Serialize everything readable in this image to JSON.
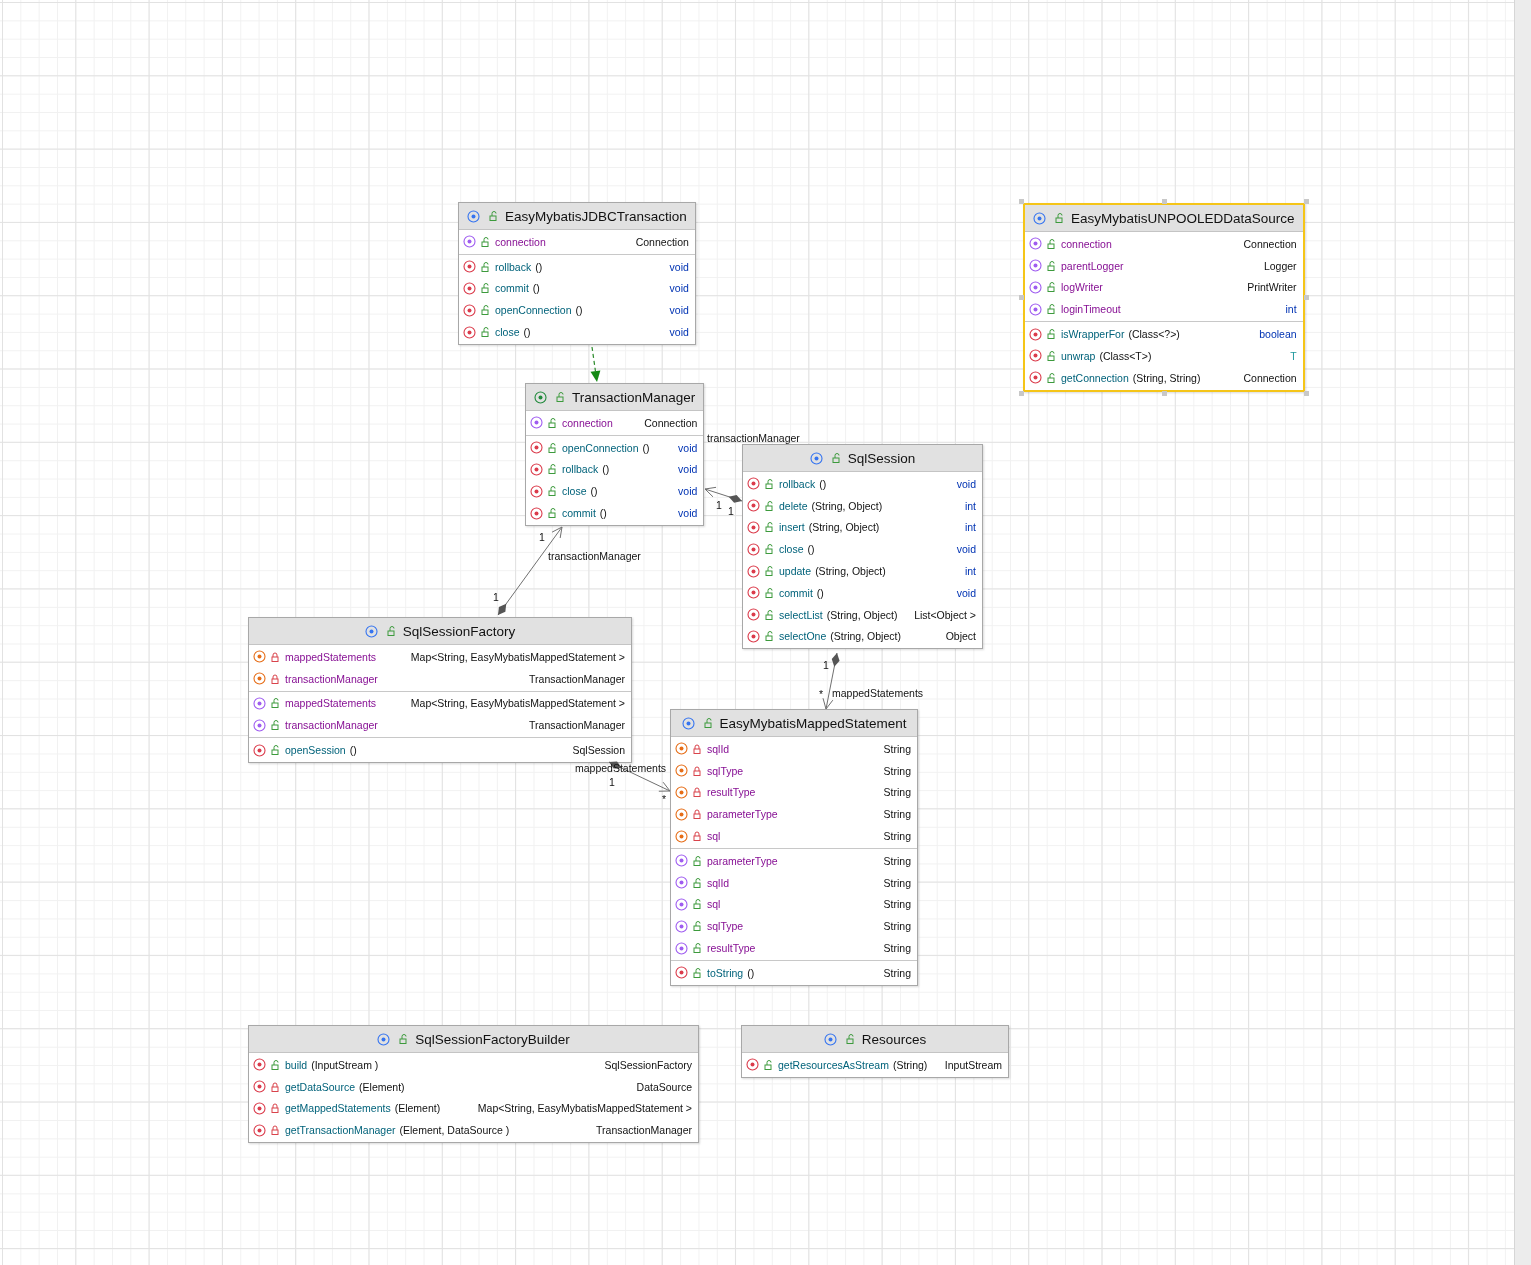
{
  "classes": [
    {
      "name": "EasyMybatisJDBCTransaction",
      "kind": "class",
      "selected": false,
      "sections": [
        {
          "members": [
            {
              "kind": "property",
              "private": false,
              "name": "connection",
              "type": "Connection",
              "keyword_type": false,
              "type_parameter": false
            }
          ]
        },
        {
          "members": [
            {
              "kind": "method",
              "private": false,
              "name": "rollback",
              "params": "()",
              "type": "void",
              "keyword_type": true,
              "type_parameter": false
            },
            {
              "kind": "method",
              "private": false,
              "name": "commit",
              "params": "()",
              "type": "void",
              "keyword_type": true,
              "type_parameter": false
            },
            {
              "kind": "method",
              "private": false,
              "name": "openConnection",
              "params": "()",
              "type": "void",
              "keyword_type": true,
              "type_parameter": false
            },
            {
              "kind": "method",
              "private": false,
              "name": "close",
              "params": "()",
              "type": "void",
              "keyword_type": true,
              "type_parameter": false
            }
          ]
        }
      ]
    },
    {
      "name": "TransactionManager",
      "kind": "interface",
      "selected": false,
      "sections": [
        {
          "members": [
            {
              "kind": "property",
              "private": false,
              "name": "connection",
              "type": "Connection",
              "keyword_type": false,
              "type_parameter": false
            }
          ]
        },
        {
          "members": [
            {
              "kind": "method",
              "private": false,
              "name": "openConnection",
              "params": "()",
              "type": "void",
              "keyword_type": true,
              "type_parameter": false
            },
            {
              "kind": "method",
              "private": false,
              "name": "rollback",
              "params": "()",
              "type": "void",
              "keyword_type": true,
              "type_parameter": false
            },
            {
              "kind": "method",
              "private": false,
              "name": "close",
              "params": "()",
              "type": "void",
              "keyword_type": true,
              "type_parameter": false
            },
            {
              "kind": "method",
              "private": false,
              "name": "commit",
              "params": "()",
              "type": "void",
              "keyword_type": true,
              "type_parameter": false
            }
          ]
        }
      ]
    },
    {
      "name": "SqlSession",
      "kind": "class",
      "selected": false,
      "sections": [
        {
          "members": [
            {
              "kind": "method",
              "private": false,
              "name": "rollback",
              "params": "()",
              "type": "void",
              "keyword_type": true,
              "type_parameter": false
            },
            {
              "kind": "method",
              "private": false,
              "name": "delete",
              "params": "(String, Object)",
              "type": "int",
              "keyword_type": true,
              "type_parameter": false
            },
            {
              "kind": "method",
              "private": false,
              "name": "insert",
              "params": "(String, Object)",
              "type": "int",
              "keyword_type": true,
              "type_parameter": false
            },
            {
              "kind": "method",
              "private": false,
              "name": "close",
              "params": "()",
              "type": "void",
              "keyword_type": true,
              "type_parameter": false
            },
            {
              "kind": "method",
              "private": false,
              "name": "update",
              "params": "(String, Object)",
              "type": "int",
              "keyword_type": true,
              "type_parameter": false
            },
            {
              "kind": "method",
              "private": false,
              "name": "commit",
              "params": "()",
              "type": "void",
              "keyword_type": true,
              "type_parameter": false
            },
            {
              "kind": "method",
              "private": false,
              "name": "selectList",
              "params": "(String, Object)",
              "type": "List<Object >",
              "keyword_type": false,
              "type_parameter": false
            },
            {
              "kind": "method",
              "private": false,
              "name": "selectOne",
              "params": "(String, Object)",
              "type": "Object",
              "keyword_type": false,
              "type_parameter": false
            }
          ]
        }
      ]
    },
    {
      "name": "SqlSessionFactory",
      "kind": "class",
      "selected": false,
      "sections": [
        {
          "members": [
            {
              "kind": "field",
              "private": true,
              "name": "mappedStatements",
              "type": "Map<String, EasyMybatisMappedStatement >",
              "keyword_type": false,
              "type_parameter": false
            },
            {
              "kind": "field",
              "private": true,
              "name": "transactionManager",
              "type": "TransactionManager",
              "keyword_type": false,
              "type_parameter": false
            }
          ]
        },
        {
          "members": [
            {
              "kind": "property",
              "private": false,
              "name": "mappedStatements",
              "type": "Map<String, EasyMybatisMappedStatement >",
              "keyword_type": false,
              "type_parameter": false
            },
            {
              "kind": "property",
              "private": false,
              "name": "transactionManager",
              "type": "TransactionManager",
              "keyword_type": false,
              "type_parameter": false
            }
          ]
        },
        {
          "members": [
            {
              "kind": "method",
              "private": false,
              "name": "openSession",
              "params": "()",
              "type": "SqlSession",
              "keyword_type": false,
              "type_parameter": false
            }
          ]
        }
      ]
    },
    {
      "name": "EasyMybatisMappedStatement",
      "kind": "class",
      "selected": false,
      "sections": [
        {
          "members": [
            {
              "kind": "field",
              "private": true,
              "name": "sqlId",
              "type": "String",
              "keyword_type": false,
              "type_parameter": false
            },
            {
              "kind": "field",
              "private": true,
              "name": "sqlType",
              "type": "String",
              "keyword_type": false,
              "type_parameter": false
            },
            {
              "kind": "field",
              "private": true,
              "name": "resultType",
              "type": "String",
              "keyword_type": false,
              "type_parameter": false
            },
            {
              "kind": "field",
              "private": true,
              "name": "parameterType",
              "type": "String",
              "keyword_type": false,
              "type_parameter": false
            },
            {
              "kind": "field",
              "private": true,
              "name": "sql",
              "type": "String",
              "keyword_type": false,
              "type_parameter": false
            }
          ]
        },
        {
          "members": [
            {
              "kind": "property",
              "private": false,
              "name": "parameterType",
              "type": "String",
              "keyword_type": false,
              "type_parameter": false
            },
            {
              "kind": "property",
              "private": false,
              "name": "sqlId",
              "type": "String",
              "keyword_type": false,
              "type_parameter": false
            },
            {
              "kind": "property",
              "private": false,
              "name": "sql",
              "type": "String",
              "keyword_type": false,
              "type_parameter": false
            },
            {
              "kind": "property",
              "private": false,
              "name": "sqlType",
              "type": "String",
              "keyword_type": false,
              "type_parameter": false
            },
            {
              "kind": "property",
              "private": false,
              "name": "resultType",
              "type": "String",
              "keyword_type": false,
              "type_parameter": false
            }
          ]
        },
        {
          "members": [
            {
              "kind": "method",
              "private": false,
              "name": "toString",
              "params": "()",
              "type": "String",
              "keyword_type": false,
              "type_parameter": false
            }
          ]
        }
      ]
    },
    {
      "name": "EasyMybatisUNPOOLEDDataSource",
      "kind": "class",
      "selected": true,
      "sections": [
        {
          "members": [
            {
              "kind": "property",
              "private": false,
              "name": "connection",
              "type": "Connection",
              "keyword_type": false,
              "type_parameter": false
            },
            {
              "kind": "property",
              "private": false,
              "name": "parentLogger",
              "type": "Logger",
              "keyword_type": false,
              "type_parameter": false
            },
            {
              "kind": "property",
              "private": false,
              "name": "logWriter",
              "type": "PrintWriter",
              "keyword_type": false,
              "type_parameter": false
            },
            {
              "kind": "property",
              "private": false,
              "name": "loginTimeout",
              "type": "int",
              "keyword_type": true,
              "type_parameter": false
            }
          ]
        },
        {
          "members": [
            {
              "kind": "method",
              "private": false,
              "name": "isWrapperFor",
              "params": "(Class<?>)",
              "type": "boolean",
              "keyword_type": true,
              "type_parameter": false
            },
            {
              "kind": "method",
              "private": false,
              "name": "unwrap",
              "params": "(Class<T>)",
              "type": "T",
              "keyword_type": false,
              "type_parameter": true
            },
            {
              "kind": "method",
              "private": false,
              "name": "getConnection",
              "params": "(String, String)",
              "type": "Connection",
              "keyword_type": false,
              "type_parameter": false
            }
          ]
        }
      ]
    },
    {
      "name": "SqlSessionFactoryBuilder",
      "kind": "class",
      "selected": false,
      "sections": [
        {
          "members": [
            {
              "kind": "method",
              "private": false,
              "name": "build",
              "params": "(InputStream )",
              "type": "SqlSessionFactory",
              "keyword_type": false,
              "type_parameter": false
            },
            {
              "kind": "method",
              "private": true,
              "name": "getDataSource",
              "params": "(Element)",
              "type": "DataSource",
              "keyword_type": false,
              "type_parameter": false
            },
            {
              "kind": "method",
              "private": true,
              "name": "getMappedStatements",
              "params": "(Element)",
              "type": "Map<String, EasyMybatisMappedStatement >",
              "keyword_type": false,
              "type_parameter": false
            },
            {
              "kind": "method",
              "private": true,
              "name": "getTransactionManager",
              "params": "(Element, DataSource )",
              "type": "TransactionManager",
              "keyword_type": false,
              "type_parameter": false
            }
          ]
        }
      ]
    },
    {
      "name": "Resources",
      "kind": "class",
      "selected": false,
      "sections": [
        {
          "members": [
            {
              "kind": "method",
              "private": false,
              "name": "getResourcesAsStream",
              "params": "(String)",
              "type": "InputStream",
              "keyword_type": false,
              "type_parameter": false
            }
          ]
        }
      ]
    }
  ],
  "edges": [
    {
      "kind": "realization"
    },
    {
      "kind": "composition",
      "labels": [
        "transactionManager",
        "1",
        "1"
      ]
    },
    {
      "kind": "composition",
      "labels": [
        "1",
        "transactionManager",
        "1"
      ]
    },
    {
      "kind": "composition",
      "labels": [
        "1",
        "*",
        "mappedStatements"
      ]
    },
    {
      "kind": "composition",
      "labels": [
        "1",
        "mappedStatements",
        "*"
      ]
    }
  ]
}
